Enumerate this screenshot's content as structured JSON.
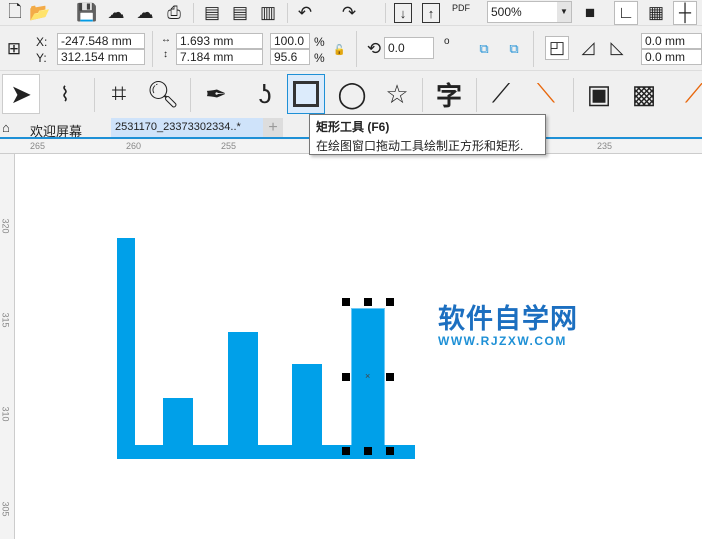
{
  "toolbar": {
    "zoom_value": "500%",
    "pdf_label": "PDF"
  },
  "property_bar": {
    "x_label": "X:",
    "y_label": "Y:",
    "x_value": "-247.548 mm",
    "y_value": "312.154 mm",
    "width_value": "1.693 mm",
    "height_value": "7.184 mm",
    "scale_x": "100.0",
    "scale_y": "95.6",
    "percent": "%",
    "rotation": "0.0",
    "degree_symbol": "o",
    "corner_1": "0.0 mm",
    "corner_2": "0.0 mm"
  },
  "tabs": {
    "welcome": "欢迎屏幕",
    "document": "2531170_23373302334..*",
    "add": "+"
  },
  "tooltip": {
    "title": "矩形工具 (F6)",
    "description": "在绘图窗口拖动工具绘制正方形和矩形."
  },
  "ruler": {
    "top": [
      "265",
      "260",
      "255",
      "235"
    ],
    "left": [
      "320",
      "315",
      "310",
      "305"
    ]
  },
  "watermark": {
    "title": "软件自学网",
    "url": "WWW.RJZXW.COM"
  },
  "colors": {
    "shape_fill": "#00a0e9",
    "accent": "#1e90d6",
    "watermark": "#1c6fc0"
  }
}
